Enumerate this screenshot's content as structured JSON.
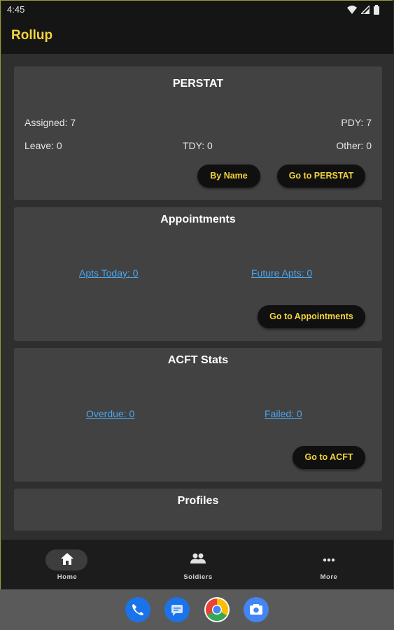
{
  "status_bar": {
    "time": "4:45"
  },
  "app_bar": {
    "title": "Rollup"
  },
  "perstat": {
    "title": "PERSTAT",
    "assigned": "Assigned: 7",
    "pdy": "PDY: 7",
    "leave": "Leave: 0",
    "tdy": "TDY: 0",
    "other": "Other: 0",
    "by_name_button": "By Name",
    "goto_button": "Go to PERSTAT"
  },
  "appointments": {
    "title": "Appointments",
    "today_link": "Apts Today: 0",
    "future_link": "Future Apts: 0",
    "goto_button": "Go to Appointments"
  },
  "acft": {
    "title": "ACFT Stats",
    "overdue_link": "Overdue: 0",
    "failed_link": "Failed: 0",
    "goto_button": "Go to ACFT"
  },
  "profiles": {
    "title": "Profiles"
  },
  "bottom_nav": {
    "items": [
      {
        "label": "Home",
        "icon": "home-icon",
        "selected": true
      },
      {
        "label": "Soldiers",
        "icon": "people-icon",
        "selected": false
      },
      {
        "label": "More",
        "icon": "more-icon",
        "selected": false
      }
    ]
  },
  "dock": {
    "apps": [
      {
        "icon": "phone-icon",
        "color": "#1a73e8"
      },
      {
        "icon": "messages-icon",
        "color": "#1a73e8"
      },
      {
        "icon": "chrome-icon",
        "color": "#34a853"
      },
      {
        "icon": "camera-icon",
        "color": "#4285f4"
      }
    ]
  },
  "colors": {
    "accent": "#f2d43c",
    "link": "#4aa6f0",
    "card": "#424242"
  }
}
